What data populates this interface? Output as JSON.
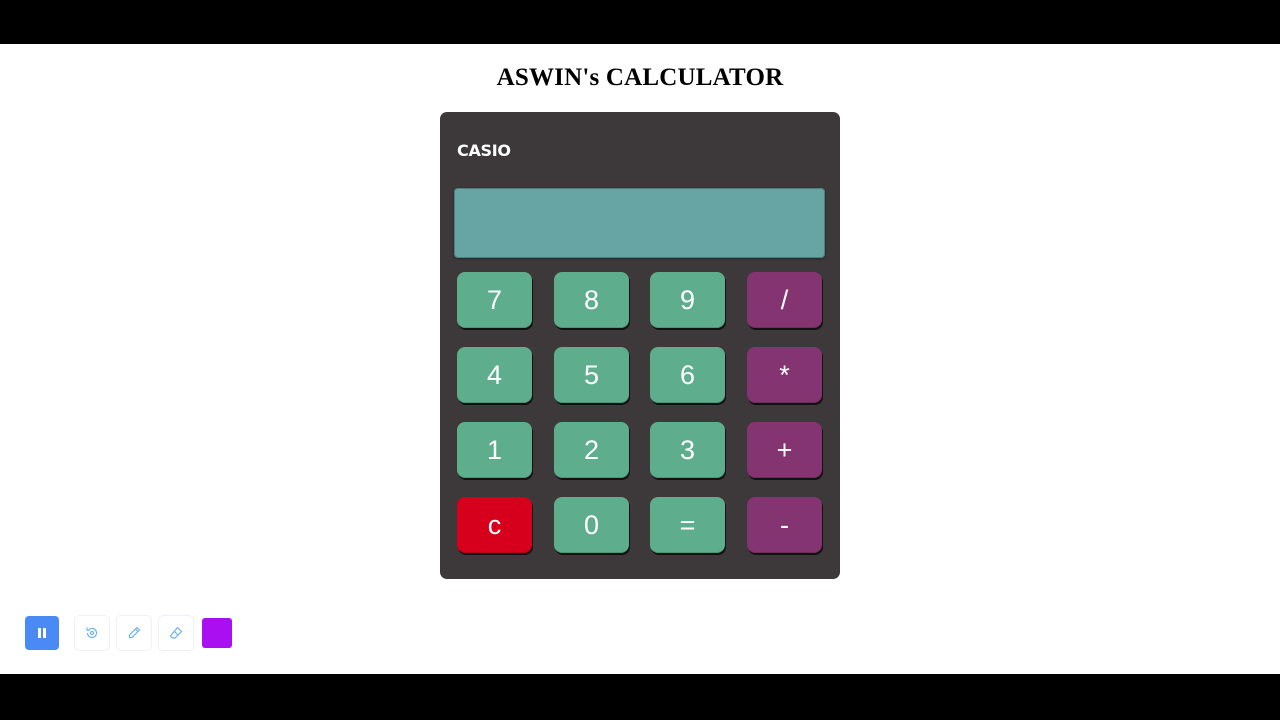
{
  "page": {
    "title": "ASWIN's CALCULATOR"
  },
  "calculator": {
    "brand": "CASIO",
    "display_value": "",
    "keys": [
      {
        "label": "7",
        "kind": "num"
      },
      {
        "label": "8",
        "kind": "num"
      },
      {
        "label": "9",
        "kind": "num"
      },
      {
        "label": "/",
        "kind": "op"
      },
      {
        "label": "4",
        "kind": "num"
      },
      {
        "label": "5",
        "kind": "num"
      },
      {
        "label": "6",
        "kind": "num"
      },
      {
        "label": "*",
        "kind": "op"
      },
      {
        "label": "1",
        "kind": "num"
      },
      {
        "label": "2",
        "kind": "num"
      },
      {
        "label": "3",
        "kind": "num"
      },
      {
        "label": "+",
        "kind": "op"
      },
      {
        "label": "c",
        "kind": "clear"
      },
      {
        "label": "0",
        "kind": "num"
      },
      {
        "label": "=",
        "kind": "num"
      },
      {
        "label": "-",
        "kind": "op"
      }
    ]
  },
  "toolbar": {
    "tools": [
      {
        "icon": "pause-icon"
      },
      {
        "icon": "replay-icon"
      },
      {
        "icon": "pen-icon"
      },
      {
        "icon": "eraser-icon"
      },
      {
        "icon": "color-swatch"
      }
    ]
  },
  "colors": {
    "number_key": "#5eae8e",
    "operator_key": "#843470",
    "clear_key": "#d7001c",
    "display": "#67a5a5",
    "calculator_body": "#3d393a",
    "pause_button": "#4a8af4",
    "color_swatch": "#a90ff0"
  }
}
